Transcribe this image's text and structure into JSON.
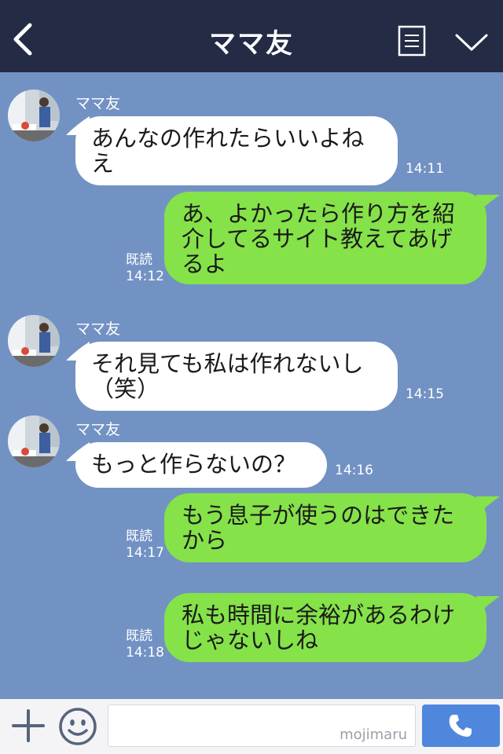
{
  "header": {
    "title": "ママ友"
  },
  "messages": [
    {
      "sender": "ママ友",
      "text": "あんなの作れたらいいよねえ",
      "time": "14:11"
    },
    {
      "text": "あ、よかったら作り方を紹介してるサイト教えてあげるよ",
      "read": "既読",
      "time": "14:12"
    },
    {
      "sender": "ママ友",
      "text": "それ見ても私は作れないし（笑）",
      "time": "14:15"
    },
    {
      "sender": "ママ友",
      "text": "もっと作らないの？",
      "time": "14:16"
    },
    {
      "text": "もう息子が使うのはできたから",
      "read": "既読",
      "time": "14:17"
    },
    {
      "text": "私も時間に余裕があるわけじゃないしね",
      "read": "既読",
      "time": "14:18"
    }
  ],
  "bottombar": {
    "watermark": "mojimaru"
  },
  "icons": [
    "back-icon",
    "notes-icon",
    "chevron-down-icon",
    "plus-icon",
    "smiley-icon",
    "phone-icon"
  ],
  "colors": {
    "header": "#232b45",
    "chat_bg": "#7292c4",
    "incoming": "#ffffff",
    "outgoing": "#85e249",
    "call_button": "#4f87dc"
  }
}
